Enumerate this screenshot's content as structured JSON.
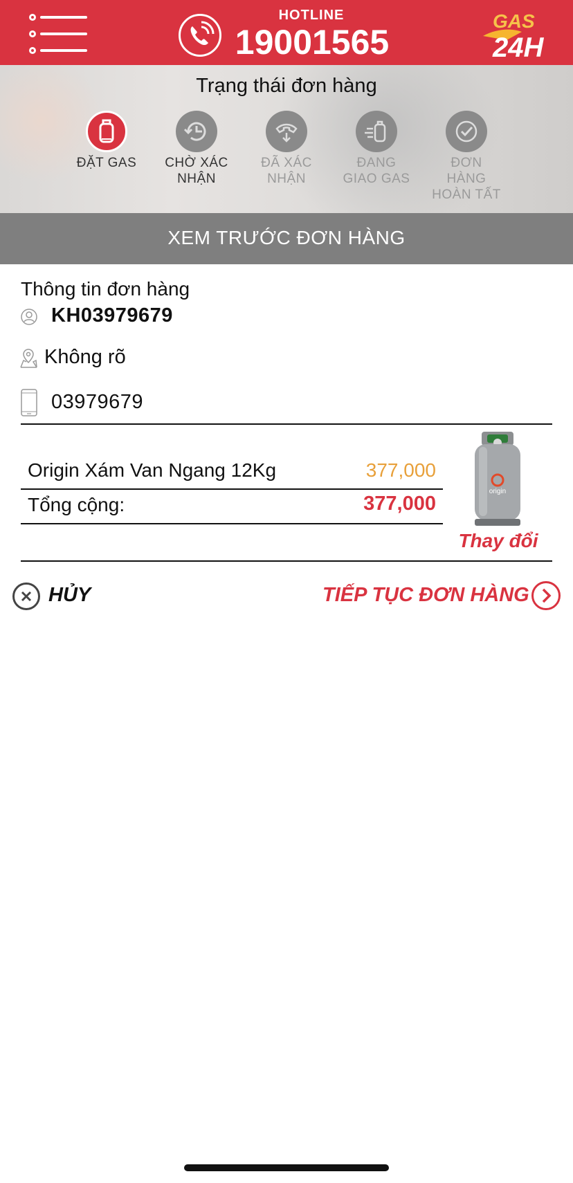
{
  "header": {
    "hotline_label": "HOTLINE",
    "hotline_number": "19001565",
    "logo_text_top": "GAS",
    "logo_text_bottom": "24H",
    "brand_color": "#d93340"
  },
  "status": {
    "title": "Trạng thái đơn hàng",
    "steps": [
      {
        "line1": "ĐẶT GAS",
        "line2": "",
        "line3": "",
        "icon": "gas-cylinder-icon",
        "state": "active"
      },
      {
        "line1": "CHỜ XÁC",
        "line2": "NHẬN",
        "line3": "",
        "icon": "clock-history-icon",
        "state": "done"
      },
      {
        "line1": "ĐÃ XÁC",
        "line2": "NHẬN",
        "line3": "",
        "icon": "phone-receiver-icon",
        "state": "pending"
      },
      {
        "line1": "ĐANG",
        "line2": "GIAO GAS",
        "line3": "",
        "icon": "delivery-cylinder-icon",
        "state": "pending"
      },
      {
        "line1": "ĐƠN",
        "line2": "HÀNG",
        "line3": "HOÀN TẤT",
        "icon": "check-circle-icon",
        "state": "pending"
      }
    ]
  },
  "section": {
    "title": "XEM TRƯỚC ĐƠN HÀNG"
  },
  "order": {
    "heading": "Thông tin đơn hàng",
    "customer_code": "KH03979679",
    "address": "Không rõ",
    "phone": "03979679"
  },
  "items": [
    {
      "name": "Origin Xám Van Ngang 12Kg",
      "price": "377,000"
    }
  ],
  "total": {
    "label": "Tổng cộng:",
    "value": "377,000"
  },
  "product_image": {
    "brand_text": "origin"
  },
  "change_label": "Thay đổi",
  "actions": {
    "cancel_label": "HỦY",
    "continue_label": "TIẾP TỤC ĐƠN HÀNG"
  }
}
